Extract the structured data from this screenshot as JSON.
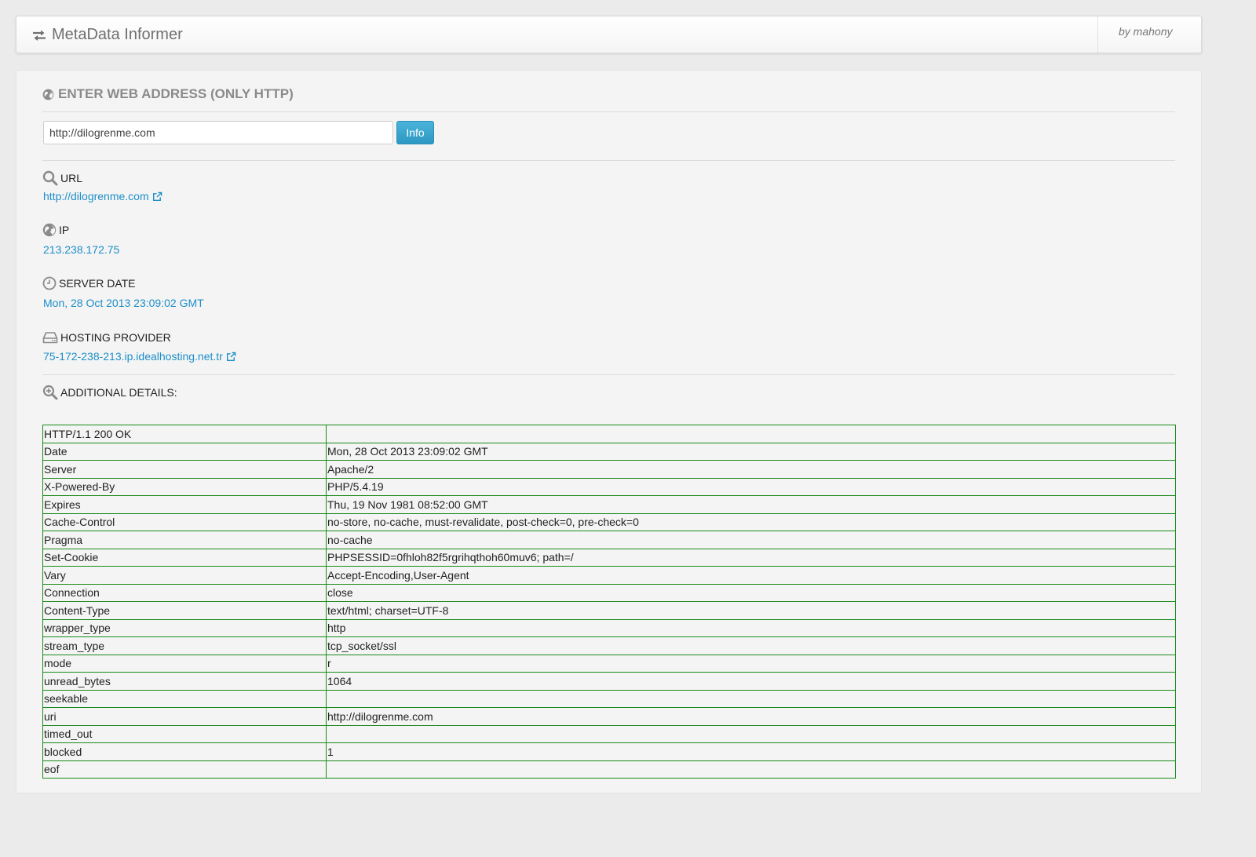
{
  "header": {
    "title": "MetaData Informer",
    "byline": "by mahony"
  },
  "form": {
    "title": "ENTER WEB ADDRESS (ONLY HTTP)",
    "url_value": "http://dilogrenme.com",
    "submit_label": "Info"
  },
  "fields": {
    "url": {
      "label": "URL",
      "value": "http://dilogrenme.com"
    },
    "ip": {
      "label": "IP",
      "value": "213.238.172.75"
    },
    "server_date": {
      "label": "SERVER DATE",
      "value": "Mon, 28 Oct 2013 23:09:02 GMT"
    },
    "hosting_provider": {
      "label": "HOSTING PROVIDER",
      "value": "75-172-238-213.ip.idealhosting.net.tr"
    }
  },
  "details": {
    "title": "ADDITIONAL DETAILS:",
    "rows": [
      {
        "key": "HTTP/1.1 200 OK",
        "value": ""
      },
      {
        "key": "Date",
        "value": "Mon, 28 Oct 2013 23:09:02 GMT"
      },
      {
        "key": "Server",
        "value": "Apache/2"
      },
      {
        "key": "X-Powered-By",
        "value": "PHP/5.4.19"
      },
      {
        "key": "Expires",
        "value": "Thu, 19 Nov 1981 08:52:00 GMT"
      },
      {
        "key": "Cache-Control",
        "value": "no-store, no-cache, must-revalidate, post-check=0, pre-check=0"
      },
      {
        "key": "Pragma",
        "value": "no-cache"
      },
      {
        "key": "Set-Cookie",
        "value": "PHPSESSID=0fhloh82f5rgrihqthoh60muv6; path=/"
      },
      {
        "key": "Vary",
        "value": "Accept-Encoding,User-Agent"
      },
      {
        "key": "Connection",
        "value": "close"
      },
      {
        "key": "Content-Type",
        "value": "text/html; charset=UTF-8"
      },
      {
        "key": "wrapper_type",
        "value": "http"
      },
      {
        "key": "stream_type",
        "value": "tcp_socket/ssl"
      },
      {
        "key": "mode",
        "value": "r"
      },
      {
        "key": "unread_bytes",
        "value": "1064"
      },
      {
        "key": "seekable",
        "value": ""
      },
      {
        "key": "uri",
        "value": "http://dilogrenme.com"
      },
      {
        "key": "timed_out",
        "value": ""
      },
      {
        "key": "blocked",
        "value": "1"
      },
      {
        "key": "eof",
        "value": ""
      }
    ]
  },
  "icons": {
    "brand": "exchange-arrows-icon",
    "section": "globe-icon",
    "url": "search-icon",
    "ip": "globe-icon",
    "server_date": "clock-icon",
    "hosting_provider": "hard-drive-icon",
    "details": "zoom-in-icon",
    "external_link": "external-link-icon"
  },
  "colors": {
    "link": "#1d8ec9",
    "button": "#2e98c4",
    "table_border": "#1a8a1a",
    "heading": "#8a8a8a"
  }
}
